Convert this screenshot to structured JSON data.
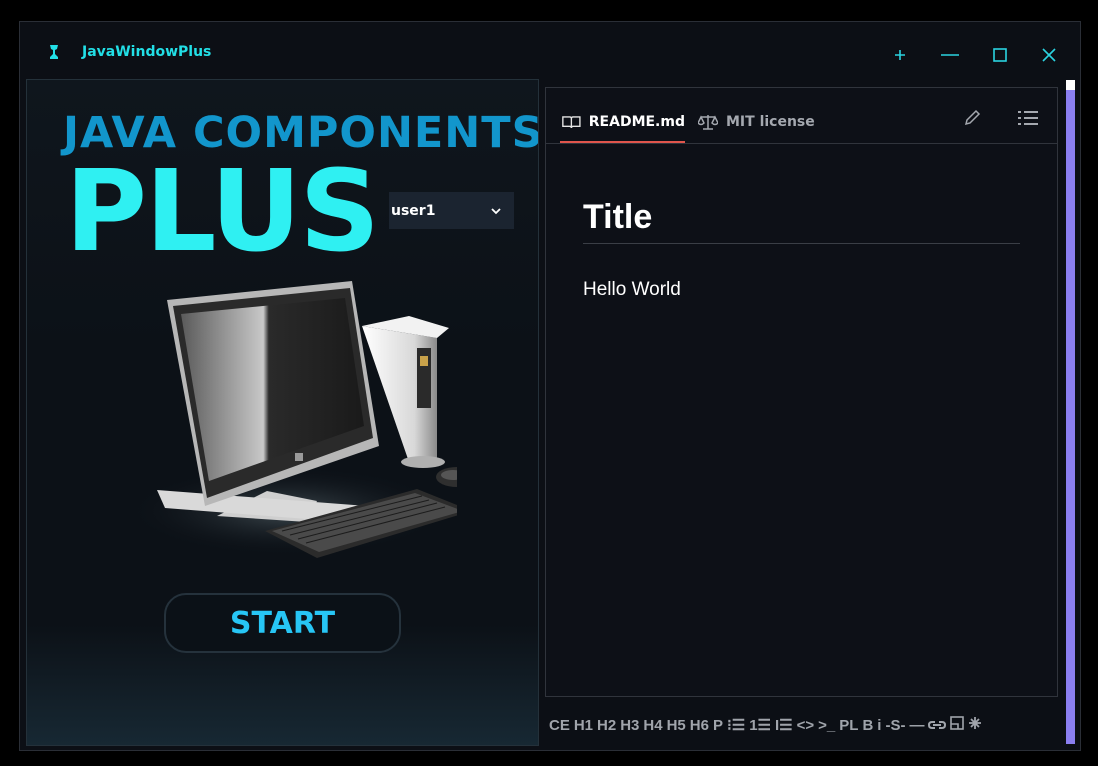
{
  "window": {
    "title": "JavaWindowPlus",
    "controls": {
      "pin_icon": "pin-icon",
      "minimize_icon": "minimize-icon",
      "maximize_icon": "maximize-icon",
      "close_icon": "close-icon"
    }
  },
  "hero": {
    "line1": "JAVA COMPONENTS",
    "line2": "PLUS",
    "user_select": {
      "value": "user1",
      "icon": "chevron-down-icon"
    },
    "start_label": "START"
  },
  "readme": {
    "tabs": [
      {
        "label": "README.md",
        "icon": "book-icon",
        "active": true
      },
      {
        "label": "MIT license",
        "icon": "scale-icon",
        "active": false
      }
    ],
    "tools": {
      "edit_icon": "pencil-icon",
      "list_icon": "list-icon"
    },
    "doc": {
      "title": "Title",
      "body": "Hello World"
    }
  },
  "md_toolbar": [
    "CE",
    "H1",
    "H2",
    "H3",
    "H4",
    "H5",
    "H6",
    "P",
    "⁝☰",
    "1☰",
    "I☰",
    "<>",
    ">_",
    "PL",
    "B",
    "i",
    "-S-",
    "—",
    "link-icon",
    "image-icon",
    "asterisk-icon"
  ],
  "colors": {
    "accent_cyan": "#2ff0f2",
    "title_blue": "#1296cc",
    "tab_underline": "#e0554c",
    "scroll_thumb": "#8b7ff0"
  }
}
